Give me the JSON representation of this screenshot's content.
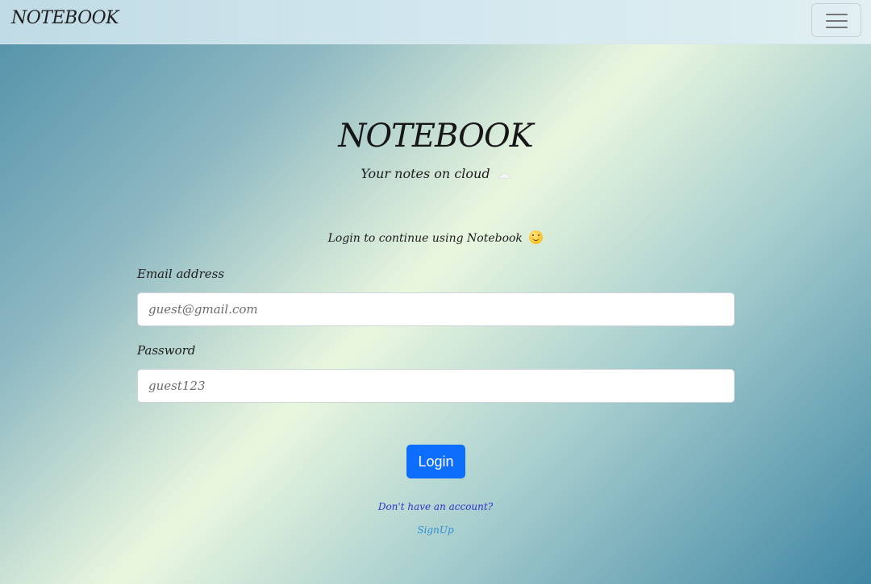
{
  "navbar": {
    "brand": "NOTEBOOK",
    "menu_icon": "hamburger-menu-icon"
  },
  "hero": {
    "title": "NOTEBOOK",
    "subtitle": "Your notes on cloud",
    "subtitle_icon": "cloud-icon",
    "cloud_glyph": "☁"
  },
  "login": {
    "prompt": "Login to continue using Notebook",
    "prompt_icon": "smile-icon",
    "email_label": "Email address",
    "email_placeholder": "guest@gmail.com",
    "password_label": "Password",
    "password_placeholder": "guest123",
    "submit_label": "Login",
    "no_account_text": "Don't have an account?",
    "signup_label": "SignUp"
  },
  "colors": {
    "primary_button": "#0d6efd",
    "no_account_text": "#3232c8",
    "signup_link": "#2e8fd6"
  }
}
